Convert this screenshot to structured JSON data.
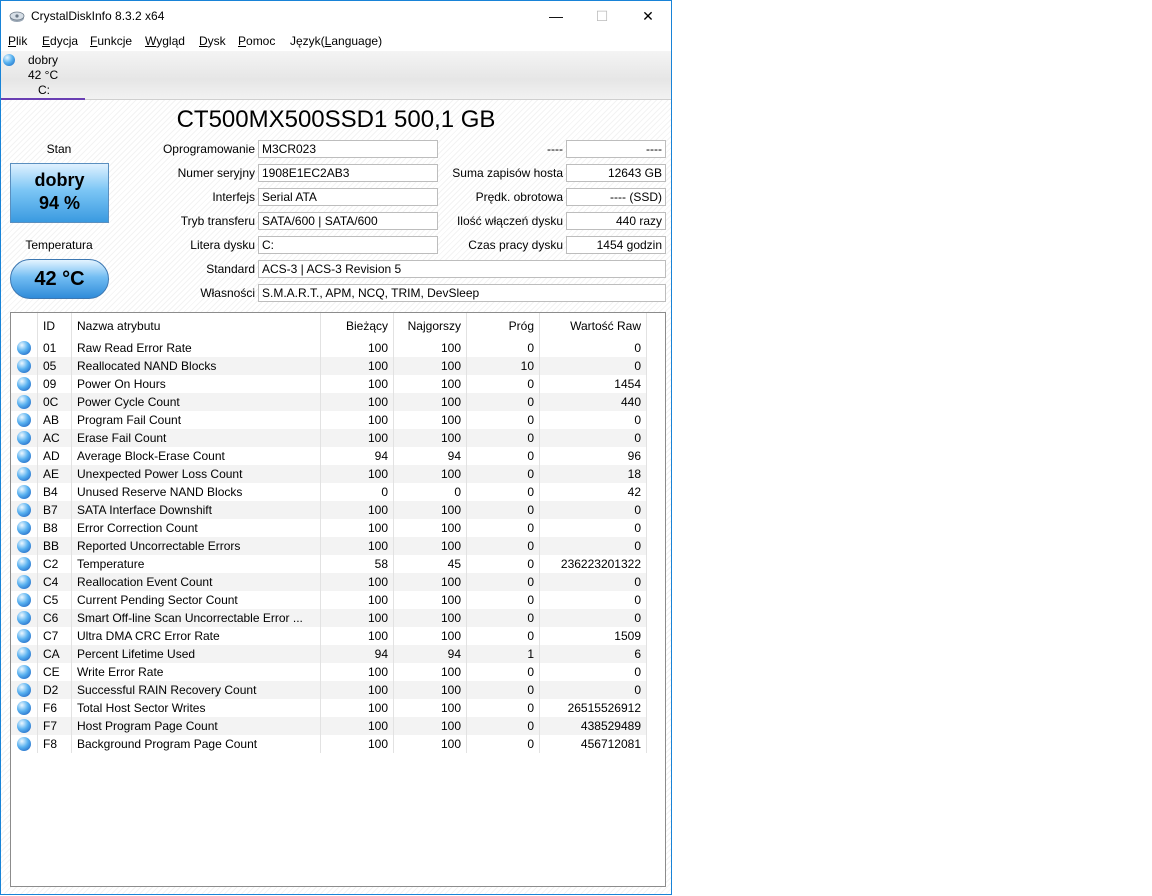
{
  "window": {
    "title": "CrystalDiskInfo 8.3.2 x64"
  },
  "menu": [
    {
      "pre": "",
      "u": "P",
      "post": "lik"
    },
    {
      "pre": "",
      "u": "E",
      "post": "dycja"
    },
    {
      "pre": "",
      "u": "F",
      "post": "unkcje"
    },
    {
      "pre": "",
      "u": "W",
      "post": "ygląd"
    },
    {
      "pre": "",
      "u": "D",
      "post": "ysk"
    },
    {
      "pre": "",
      "u": "P",
      "post": "omoc"
    },
    {
      "pre": "Język(",
      "u": "L",
      "post": "anguage)"
    }
  ],
  "disk_tab": {
    "state": "dobry",
    "temp": "42 °C",
    "letter": "C:"
  },
  "disk_title": "CT500MX500SSD1 500,1 GB",
  "status": {
    "label": "Stan",
    "state": "dobry",
    "percent": "94 %"
  },
  "temperature": {
    "label": "Temperatura",
    "value": "42 °C"
  },
  "fields_left": [
    {
      "label": "Oprogramowanie",
      "value": "M3CR023"
    },
    {
      "label": "Numer seryjny",
      "value": "1908E1EC2AB3"
    },
    {
      "label": "Interfejs",
      "value": "Serial ATA"
    },
    {
      "label": "Tryb transferu",
      "value": "SATA/600 | SATA/600"
    },
    {
      "label": "Litera dysku",
      "value": "C:"
    }
  ],
  "fields_right": [
    {
      "label": "----",
      "value": "----"
    },
    {
      "label": "Suma zapisów hosta",
      "value": "12643 GB"
    },
    {
      "label": "Prędk. obrotowa",
      "value": "---- (SSD)"
    },
    {
      "label": "Ilość włączeń dysku",
      "value": "440 razy"
    },
    {
      "label": "Czas pracy dysku",
      "value": "1454 godzin"
    }
  ],
  "fields_wide": [
    {
      "label": "Standard",
      "value": "ACS-3 | ACS-3 Revision 5"
    },
    {
      "label": "Własności",
      "value": "S.M.A.R.T., APM, NCQ, TRIM, DevSleep"
    }
  ],
  "smart": {
    "headers": [
      "ID",
      "Nazwa atrybutu",
      "Bieżący",
      "Najgorszy",
      "Próg",
      "Wartość Raw"
    ],
    "rows": [
      [
        "01",
        "Raw Read Error Rate",
        "100",
        "100",
        "0",
        "0"
      ],
      [
        "05",
        "Reallocated NAND Blocks",
        "100",
        "100",
        "10",
        "0"
      ],
      [
        "09",
        "Power On Hours",
        "100",
        "100",
        "0",
        "1454"
      ],
      [
        "0C",
        "Power Cycle Count",
        "100",
        "100",
        "0",
        "440"
      ],
      [
        "AB",
        "Program Fail Count",
        "100",
        "100",
        "0",
        "0"
      ],
      [
        "AC",
        "Erase Fail Count",
        "100",
        "100",
        "0",
        "0"
      ],
      [
        "AD",
        "Average Block-Erase Count",
        "94",
        "94",
        "0",
        "96"
      ],
      [
        "AE",
        "Unexpected Power Loss Count",
        "100",
        "100",
        "0",
        "18"
      ],
      [
        "B4",
        "Unused Reserve NAND Blocks",
        "0",
        "0",
        "0",
        "42"
      ],
      [
        "B7",
        "SATA Interface Downshift",
        "100",
        "100",
        "0",
        "0"
      ],
      [
        "B8",
        "Error Correction Count",
        "100",
        "100",
        "0",
        "0"
      ],
      [
        "BB",
        "Reported Uncorrectable Errors",
        "100",
        "100",
        "0",
        "0"
      ],
      [
        "C2",
        "Temperature",
        "58",
        "45",
        "0",
        "236223201322"
      ],
      [
        "C4",
        "Reallocation Event Count",
        "100",
        "100",
        "0",
        "0"
      ],
      [
        "C5",
        "Current Pending Sector Count",
        "100",
        "100",
        "0",
        "0"
      ],
      [
        "C6",
        "Smart Off-line Scan Uncorrectable Error ...",
        "100",
        "100",
        "0",
        "0"
      ],
      [
        "C7",
        "Ultra DMA CRC Error Rate",
        "100",
        "100",
        "0",
        "1509"
      ],
      [
        "CA",
        "Percent Lifetime Used",
        "94",
        "94",
        "1",
        "6"
      ],
      [
        "CE",
        "Write Error Rate",
        "100",
        "100",
        "0",
        "0"
      ],
      [
        "D2",
        "Successful RAIN Recovery Count",
        "100",
        "100",
        "0",
        "0"
      ],
      [
        "F6",
        "Total Host Sector Writes",
        "100",
        "100",
        "0",
        "26515526912"
      ],
      [
        "F7",
        "Host Program Page Count",
        "100",
        "100",
        "0",
        "438529489"
      ],
      [
        "F8",
        "Background Program Page Count",
        "100",
        "100",
        "0",
        "456712081"
      ]
    ]
  }
}
